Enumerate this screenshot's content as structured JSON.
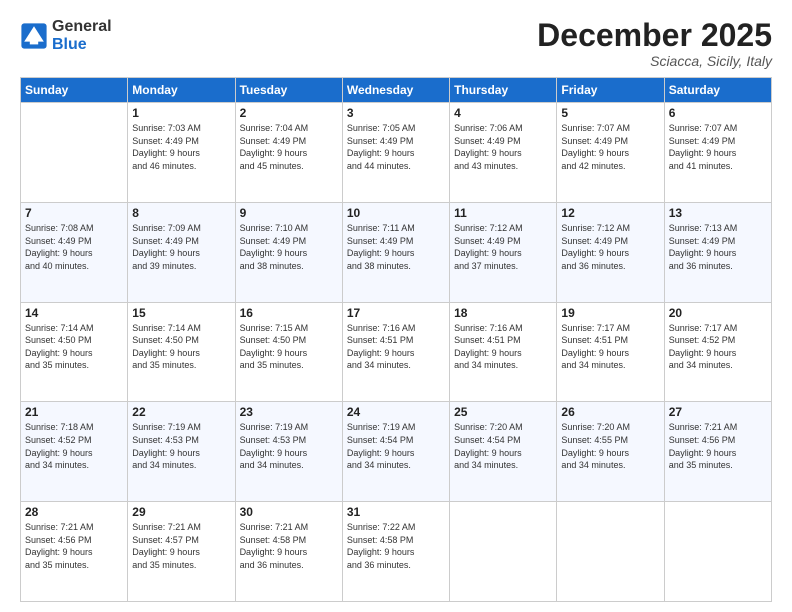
{
  "header": {
    "logo": {
      "line1": "General",
      "line2": "Blue"
    },
    "title": "December 2025",
    "location": "Sciacca, Sicily, Italy"
  },
  "days_of_week": [
    "Sunday",
    "Monday",
    "Tuesday",
    "Wednesday",
    "Thursday",
    "Friday",
    "Saturday"
  ],
  "weeks": [
    [
      {
        "day": "",
        "info": ""
      },
      {
        "day": "1",
        "info": "Sunrise: 7:03 AM\nSunset: 4:49 PM\nDaylight: 9 hours\nand 46 minutes."
      },
      {
        "day": "2",
        "info": "Sunrise: 7:04 AM\nSunset: 4:49 PM\nDaylight: 9 hours\nand 45 minutes."
      },
      {
        "day": "3",
        "info": "Sunrise: 7:05 AM\nSunset: 4:49 PM\nDaylight: 9 hours\nand 44 minutes."
      },
      {
        "day": "4",
        "info": "Sunrise: 7:06 AM\nSunset: 4:49 PM\nDaylight: 9 hours\nand 43 minutes."
      },
      {
        "day": "5",
        "info": "Sunrise: 7:07 AM\nSunset: 4:49 PM\nDaylight: 9 hours\nand 42 minutes."
      },
      {
        "day": "6",
        "info": "Sunrise: 7:07 AM\nSunset: 4:49 PM\nDaylight: 9 hours\nand 41 minutes."
      }
    ],
    [
      {
        "day": "7",
        "info": "Sunrise: 7:08 AM\nSunset: 4:49 PM\nDaylight: 9 hours\nand 40 minutes."
      },
      {
        "day": "8",
        "info": "Sunrise: 7:09 AM\nSunset: 4:49 PM\nDaylight: 9 hours\nand 39 minutes."
      },
      {
        "day": "9",
        "info": "Sunrise: 7:10 AM\nSunset: 4:49 PM\nDaylight: 9 hours\nand 38 minutes."
      },
      {
        "day": "10",
        "info": "Sunrise: 7:11 AM\nSunset: 4:49 PM\nDaylight: 9 hours\nand 38 minutes."
      },
      {
        "day": "11",
        "info": "Sunrise: 7:12 AM\nSunset: 4:49 PM\nDaylight: 9 hours\nand 37 minutes."
      },
      {
        "day": "12",
        "info": "Sunrise: 7:12 AM\nSunset: 4:49 PM\nDaylight: 9 hours\nand 36 minutes."
      },
      {
        "day": "13",
        "info": "Sunrise: 7:13 AM\nSunset: 4:49 PM\nDaylight: 9 hours\nand 36 minutes."
      }
    ],
    [
      {
        "day": "14",
        "info": "Sunrise: 7:14 AM\nSunset: 4:50 PM\nDaylight: 9 hours\nand 35 minutes."
      },
      {
        "day": "15",
        "info": "Sunrise: 7:14 AM\nSunset: 4:50 PM\nDaylight: 9 hours\nand 35 minutes."
      },
      {
        "day": "16",
        "info": "Sunrise: 7:15 AM\nSunset: 4:50 PM\nDaylight: 9 hours\nand 35 minutes."
      },
      {
        "day": "17",
        "info": "Sunrise: 7:16 AM\nSunset: 4:51 PM\nDaylight: 9 hours\nand 34 minutes."
      },
      {
        "day": "18",
        "info": "Sunrise: 7:16 AM\nSunset: 4:51 PM\nDaylight: 9 hours\nand 34 minutes."
      },
      {
        "day": "19",
        "info": "Sunrise: 7:17 AM\nSunset: 4:51 PM\nDaylight: 9 hours\nand 34 minutes."
      },
      {
        "day": "20",
        "info": "Sunrise: 7:17 AM\nSunset: 4:52 PM\nDaylight: 9 hours\nand 34 minutes."
      }
    ],
    [
      {
        "day": "21",
        "info": "Sunrise: 7:18 AM\nSunset: 4:52 PM\nDaylight: 9 hours\nand 34 minutes."
      },
      {
        "day": "22",
        "info": "Sunrise: 7:19 AM\nSunset: 4:53 PM\nDaylight: 9 hours\nand 34 minutes."
      },
      {
        "day": "23",
        "info": "Sunrise: 7:19 AM\nSunset: 4:53 PM\nDaylight: 9 hours\nand 34 minutes."
      },
      {
        "day": "24",
        "info": "Sunrise: 7:19 AM\nSunset: 4:54 PM\nDaylight: 9 hours\nand 34 minutes."
      },
      {
        "day": "25",
        "info": "Sunrise: 7:20 AM\nSunset: 4:54 PM\nDaylight: 9 hours\nand 34 minutes."
      },
      {
        "day": "26",
        "info": "Sunrise: 7:20 AM\nSunset: 4:55 PM\nDaylight: 9 hours\nand 34 minutes."
      },
      {
        "day": "27",
        "info": "Sunrise: 7:21 AM\nSunset: 4:56 PM\nDaylight: 9 hours\nand 35 minutes."
      }
    ],
    [
      {
        "day": "28",
        "info": "Sunrise: 7:21 AM\nSunset: 4:56 PM\nDaylight: 9 hours\nand 35 minutes."
      },
      {
        "day": "29",
        "info": "Sunrise: 7:21 AM\nSunset: 4:57 PM\nDaylight: 9 hours\nand 35 minutes."
      },
      {
        "day": "30",
        "info": "Sunrise: 7:21 AM\nSunset: 4:58 PM\nDaylight: 9 hours\nand 36 minutes."
      },
      {
        "day": "31",
        "info": "Sunrise: 7:22 AM\nSunset: 4:58 PM\nDaylight: 9 hours\nand 36 minutes."
      },
      {
        "day": "",
        "info": ""
      },
      {
        "day": "",
        "info": ""
      },
      {
        "day": "",
        "info": ""
      }
    ]
  ]
}
